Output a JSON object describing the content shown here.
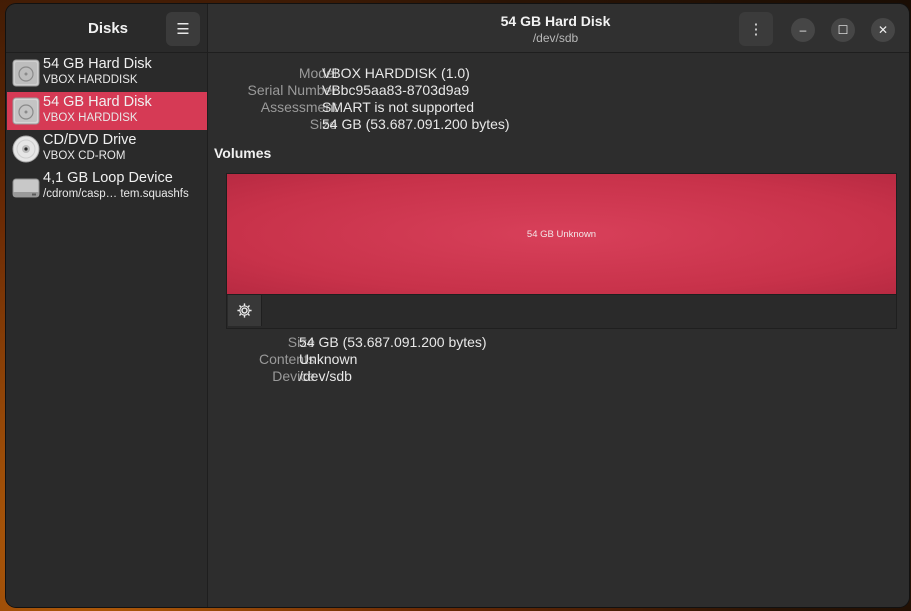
{
  "sidebar": {
    "title": "Disks",
    "devices": [
      {
        "name": "54 GB Hard Disk",
        "sub": "VBOX HARDDISK",
        "icon": "hard-disk-icon",
        "selected": false
      },
      {
        "name": "54 GB Hard Disk",
        "sub": "VBOX HARDDISK",
        "icon": "hard-disk-icon",
        "selected": true
      },
      {
        "name": "CD/DVD Drive",
        "sub": "VBOX CD-ROM",
        "icon": "optical-disc-icon",
        "selected": false
      },
      {
        "name": "4,1 GB Loop Device",
        "sub": "/cdrom/casp…  tem.squashfs",
        "icon": "loop-device-icon",
        "selected": false
      }
    ]
  },
  "header": {
    "title": "54 GB Hard Disk",
    "subtitle": "/dev/sdb"
  },
  "drive": {
    "model_label": "Model",
    "model": "VBOX HARDDISK (1.0)",
    "serial_label": "Serial Number",
    "serial": "VBbc95aa83-8703d9a9",
    "assessment_label": "Assessment",
    "assessment": "SMART is not supported",
    "size_label": "Size",
    "size": "54 GB (53.687.091.200 bytes)"
  },
  "volumes": {
    "title": "Volumes",
    "bar_label": "54 GB Unknown",
    "size_label": "Size",
    "size": "54 GB (53.687.091.200 bytes)",
    "contents_label": "Contents",
    "contents": "Unknown",
    "device_label": "Device",
    "device": "/dev/sdb"
  },
  "colors": {
    "accent": "#d63a55",
    "window_bg": "#2d2d2d"
  }
}
